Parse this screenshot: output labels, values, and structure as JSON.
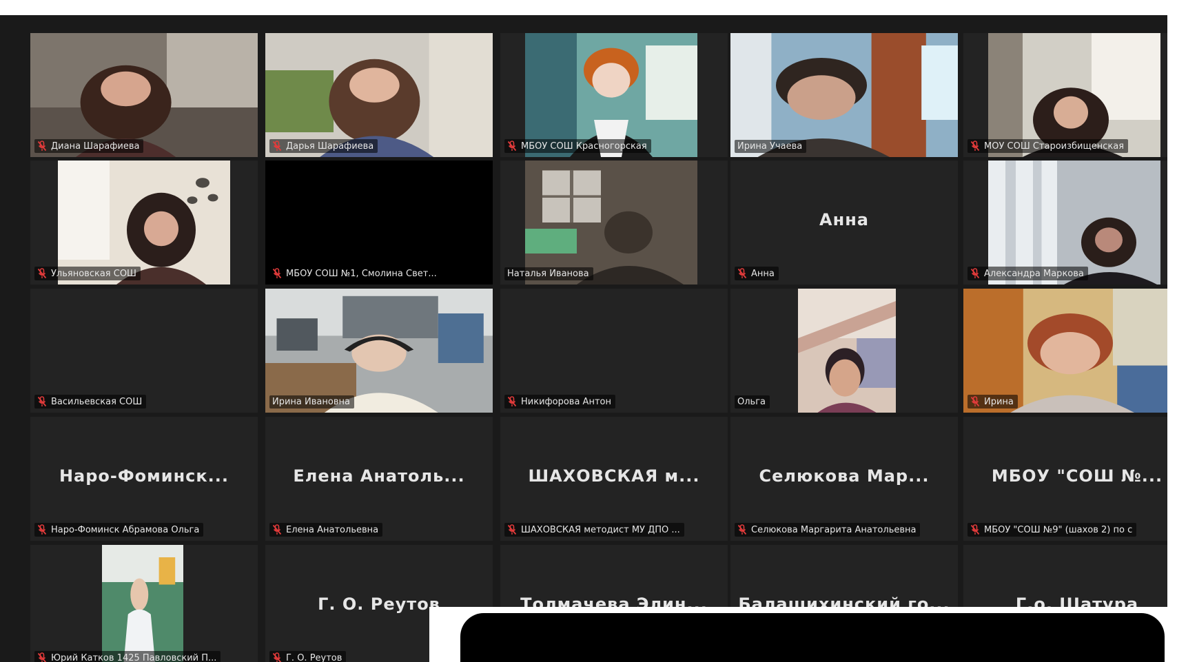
{
  "app": {
    "name": "Video conference gallery view",
    "active_speaker_color": "#c5d86d",
    "background": "#1a1a1a",
    "muted_icon_color": "#e23b3b"
  },
  "participants": [
    {
      "id": "p1",
      "label": "Диана Шарафиева",
      "muted": true,
      "video": true,
      "active": false,
      "video_scene": "woman-dark-hair"
    },
    {
      "id": "p2",
      "label": "Дарья Шарафиева",
      "muted": true,
      "video": true,
      "active": false,
      "video_scene": "woman-long-hair"
    },
    {
      "id": "p3",
      "label": "МБОУ СОШ Красногорская",
      "muted": true,
      "video": true,
      "active": false,
      "video_scene": "woman-red-hair"
    },
    {
      "id": "p4",
      "label": "Ирина Учаева",
      "muted": false,
      "video": true,
      "active": true,
      "video_scene": "woman-short-hair"
    },
    {
      "id": "p5",
      "label": "МОУ СОШ Староизбищенская",
      "muted": true,
      "video": true,
      "active": false,
      "video_scene": "woman-window"
    },
    {
      "id": "p6",
      "label": "Ульяновская СОШ",
      "muted": true,
      "video": true,
      "active": false,
      "video_scene": "girl-room"
    },
    {
      "id": "p7",
      "label": "МБОУ СОШ №1, Смолина Свет...",
      "muted": true,
      "video": true,
      "active": false,
      "video_scene": "black"
    },
    {
      "id": "p8",
      "label": "Наталья Иванова",
      "muted": false,
      "video": true,
      "active": false,
      "video_scene": "dim-room"
    },
    {
      "id": "p9",
      "label": "Анна",
      "center_name": "Анна",
      "muted": true,
      "video": false,
      "active": false
    },
    {
      "id": "p10",
      "label": "Александра Маркова",
      "muted": true,
      "video": true,
      "active": false,
      "video_scene": "woman-curtain"
    },
    {
      "id": "p11",
      "label": "Васильевская СОШ",
      "muted": true,
      "video": false,
      "active": false
    },
    {
      "id": "p12",
      "label": "Ирина Ивановна",
      "muted": false,
      "video": true,
      "active": false,
      "video_scene": "office-headset"
    },
    {
      "id": "p13",
      "label": "Никифорова Антон",
      "muted": true,
      "video": false,
      "active": false
    },
    {
      "id": "p14",
      "label": "Ольга",
      "muted": false,
      "video": true,
      "active": false,
      "video_scene": "woman-lying"
    },
    {
      "id": "p15",
      "label": "Ирина",
      "muted": true,
      "video": true,
      "active": false,
      "video_scene": "woman-glasses"
    },
    {
      "id": "p16",
      "label": "Наро-Фоминск Абрамова Ольга",
      "center_name": "Наро-Фоминск...",
      "muted": true,
      "video": false,
      "active": false
    },
    {
      "id": "p17",
      "label": "Елена Анатольевна",
      "center_name": "Елена Анатоль...",
      "muted": true,
      "video": false,
      "active": false
    },
    {
      "id": "p18",
      "label": "ШАХОВСКАЯ методист МУ ДПО ...",
      "center_name": "ШАХОВСКАЯ м...",
      "muted": true,
      "video": false,
      "active": false
    },
    {
      "id": "p19",
      "label": "Селюкова Маргарита Анатольевна",
      "center_name": "Селюкова Мар...",
      "muted": true,
      "video": false,
      "active": false
    },
    {
      "id": "p20",
      "label": "МБОУ \"СОШ №9\" (шахов 2) по с",
      "center_name": "МБОУ \"СОШ №...",
      "muted": true,
      "video": false,
      "active": false
    },
    {
      "id": "p21",
      "label": "Юрий Катков 1425 Павловский П...",
      "muted": true,
      "video": true,
      "active": false,
      "video_scene": "classroom-child"
    },
    {
      "id": "p22",
      "label": "Г. О. Реутов",
      "center_name": "Г. О. Реутов",
      "muted": true,
      "video": false,
      "active": false
    },
    {
      "id": "p23",
      "label": "",
      "center_name": "Толмачева Элин...",
      "muted": false,
      "video": false,
      "active": false
    },
    {
      "id": "p24",
      "label": "",
      "center_name": "Балашихинский го...",
      "muted": false,
      "video": false,
      "active": false
    },
    {
      "id": "p25",
      "label": "",
      "center_name": "Г.о. Шатура",
      "muted": false,
      "video": false,
      "active": false
    }
  ]
}
